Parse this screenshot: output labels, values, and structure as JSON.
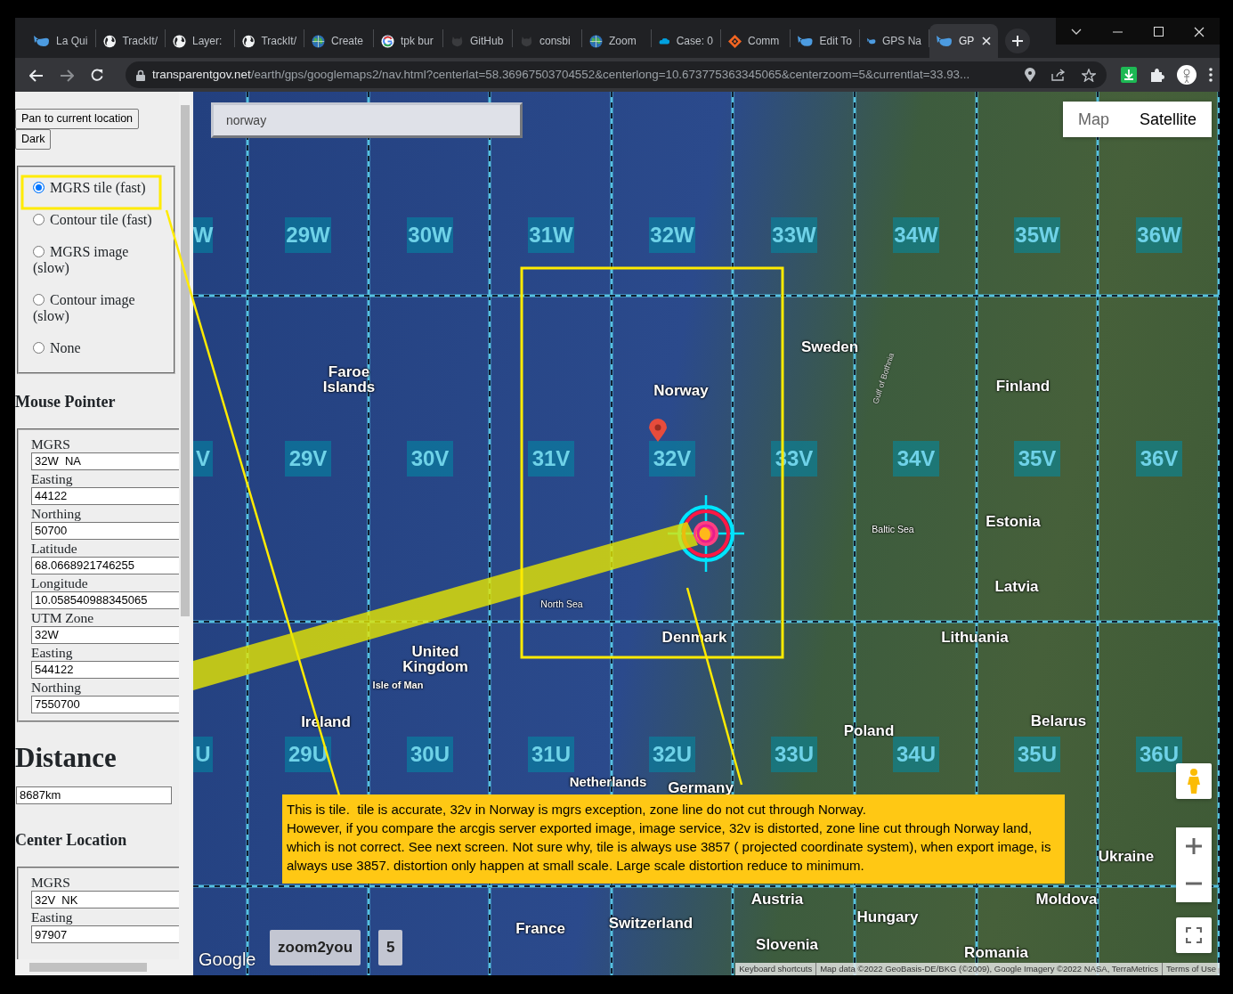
{
  "browser": {
    "tabs": [
      {
        "label": "La Qui",
        "selected": false
      },
      {
        "label": "TrackIt/",
        "selected": false
      },
      {
        "label": "Layer:",
        "selected": false
      },
      {
        "label": "TrackIt/",
        "selected": false
      },
      {
        "label": "Create",
        "selected": false
      },
      {
        "label": "tpk bur",
        "selected": false
      },
      {
        "label": "GitHub",
        "selected": false
      },
      {
        "label": "consbi",
        "selected": false
      },
      {
        "label": "Zoom",
        "selected": false
      },
      {
        "label": "Case: 0",
        "selected": false
      },
      {
        "label": "Comm",
        "selected": false
      },
      {
        "label": "Edit To",
        "selected": false
      },
      {
        "label": "GPS Na",
        "selected": false
      },
      {
        "label": "GP",
        "selected": true
      }
    ],
    "address": {
      "host": "transparentgov.net",
      "path": "/earth/gps/googlemaps2/nav.html?centerlat=58.36967503704552&centerlong=10.673775363345065&centerzoom=5&currentlat=33.93..."
    }
  },
  "sidebar": {
    "buttons": [
      "Pan to current location",
      "Dark"
    ],
    "layer_options": [
      {
        "label": "MGRS tile (fast)",
        "selected": true
      },
      {
        "label": "Contour tile (fast)",
        "selected": false
      },
      {
        "label": "MGRS image (slow)",
        "selected": false
      },
      {
        "label": "Contour image (slow)",
        "selected": false
      },
      {
        "label": "None",
        "selected": false
      }
    ],
    "mouse_pointer": {
      "title": "Mouse Pointer",
      "fields": [
        {
          "label": "MGRS",
          "value": "32W  NA"
        },
        {
          "label": "Easting",
          "value": "44122"
        },
        {
          "label": "Northing",
          "value": "50700"
        },
        {
          "label": "Latitude",
          "value": "68.0668921746255"
        },
        {
          "label": "Longitude",
          "value": "10.058540988345065"
        },
        {
          "label": "UTM Zone",
          "value": "32W"
        },
        {
          "label": "Easting",
          "value": "544122"
        },
        {
          "label": "Northing",
          "value": "7550700"
        }
      ]
    },
    "distance": {
      "title": "Distance",
      "value": "8687km"
    },
    "center_location": {
      "title": "Center Location",
      "fields": [
        {
          "label": "MGRS",
          "value": "32V  NK"
        },
        {
          "label": "Easting",
          "value": "97907"
        }
      ]
    }
  },
  "map": {
    "search": {
      "value": "norway"
    },
    "map_types": [
      {
        "label": "Map",
        "selected": false
      },
      {
        "label": "Satellite",
        "selected": true
      }
    ],
    "zone_rows": [
      [
        "W",
        "29W",
        "30W",
        "31W",
        "32W",
        "33W",
        "34W",
        "35W",
        "36W"
      ],
      [
        "V",
        "29V",
        "30V",
        "31V",
        "32V",
        "33V",
        "34V",
        "35V",
        "36V"
      ],
      [
        "U",
        "29U",
        "30U",
        "31U",
        "32U",
        "33U",
        "34U",
        "35U",
        "36U"
      ]
    ],
    "places": [
      {
        "label": "Faroe Islands",
        "kind": "country"
      },
      {
        "label": "Sweden",
        "kind": "country"
      },
      {
        "label": "Gulf of Bothnia",
        "kind": "gulf"
      },
      {
        "label": "Norway",
        "kind": "country"
      },
      {
        "label": "Finland",
        "kind": "country"
      },
      {
        "label": "Estonia",
        "kind": "country"
      },
      {
        "label": "Baltic Sea",
        "kind": "sea"
      },
      {
        "label": "Latvia",
        "kind": "country"
      },
      {
        "label": "North Sea",
        "kind": "sea"
      },
      {
        "label": "Denmark",
        "kind": "country"
      },
      {
        "label": "Lithuania",
        "kind": "country"
      },
      {
        "label": "United Kingdom",
        "kind": "country"
      },
      {
        "label": "Isle of Man",
        "kind": "island"
      },
      {
        "label": "Ireland",
        "kind": "country"
      },
      {
        "label": "Belarus",
        "kind": "country"
      },
      {
        "label": "Poland",
        "kind": "country"
      },
      {
        "label": "Netherlands",
        "kind": "country"
      },
      {
        "label": "Germany",
        "kind": "country"
      },
      {
        "label": "Ukraine",
        "kind": "country"
      },
      {
        "label": "Austria",
        "kind": "country"
      },
      {
        "label": "Moldova",
        "kind": "country"
      },
      {
        "label": "Hungary",
        "kind": "country"
      },
      {
        "label": "Switzerland",
        "kind": "country"
      },
      {
        "label": "France",
        "kind": "country"
      },
      {
        "label": "Slovenia",
        "kind": "country"
      },
      {
        "label": "Romania",
        "kind": "country"
      }
    ],
    "note": [
      "This is tile.  tile is accurate, 32v in Norway is mgrs exception, zone line do not cut through Norway.",
      "However, if you compare the arcgis server exported image, image service, 32v is distorted, zone line cut through Norway land, which is not correct. See next screen. Not sure why, tile is always use 3857 ( projected coordinate system), when export image, is always use 3857. distortion only happen at small scale. Large scale distortion reduce to minimum."
    ],
    "buttons": [
      "zoom2you",
      "5"
    ],
    "logo": "Google",
    "attribution": [
      "Keyboard shortcuts",
      "Map data ©2022 GeoBasis-DE/BKG (©2009), Google Imagery ©2022 NASA, TerraMetrics",
      "Terms of Use"
    ]
  }
}
